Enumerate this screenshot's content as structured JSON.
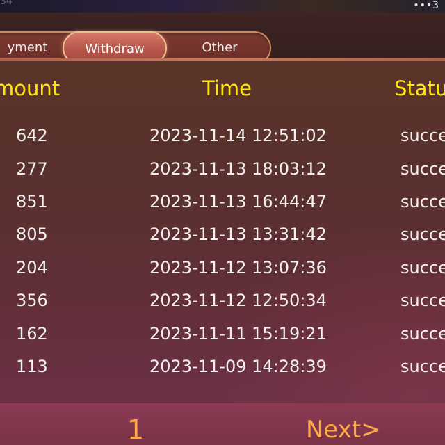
{
  "statusbar": {
    "ghost_text": "34",
    "more_label": "•••3"
  },
  "tabs": [
    {
      "label": "yment",
      "active": false
    },
    {
      "label": "Withdraw",
      "active": true
    },
    {
      "label": "Other",
      "active": false
    }
  ],
  "table": {
    "headers": {
      "amount": "mount",
      "time": "Time",
      "status": "Statu"
    },
    "rows": [
      {
        "amount": "642",
        "time": "2023-11-14 12:51:02",
        "status": "succe"
      },
      {
        "amount": "277",
        "time": "2023-11-13 18:03:12",
        "status": "succe"
      },
      {
        "amount": "851",
        "time": "2023-11-13 16:44:47",
        "status": "succe"
      },
      {
        "amount": "805",
        "time": "2023-11-13 13:31:42",
        "status": "succe"
      },
      {
        "amount": "204",
        "time": "2023-11-12 13:07:36",
        "status": "succe"
      },
      {
        "amount": "356",
        "time": "2023-11-12 12:50:34",
        "status": "succe"
      },
      {
        "amount": "162",
        "time": "2023-11-11 15:19:21",
        "status": "succe"
      },
      {
        "amount": "113",
        "time": "2023-11-09 14:28:39",
        "status": "succe"
      }
    ]
  },
  "pagination": {
    "current_page": "1",
    "next_label": "Next>"
  },
  "colors": {
    "header_text": "#ffe600",
    "pagination_text": "#ffaa44",
    "active_tab_border": "#f2c08e"
  }
}
